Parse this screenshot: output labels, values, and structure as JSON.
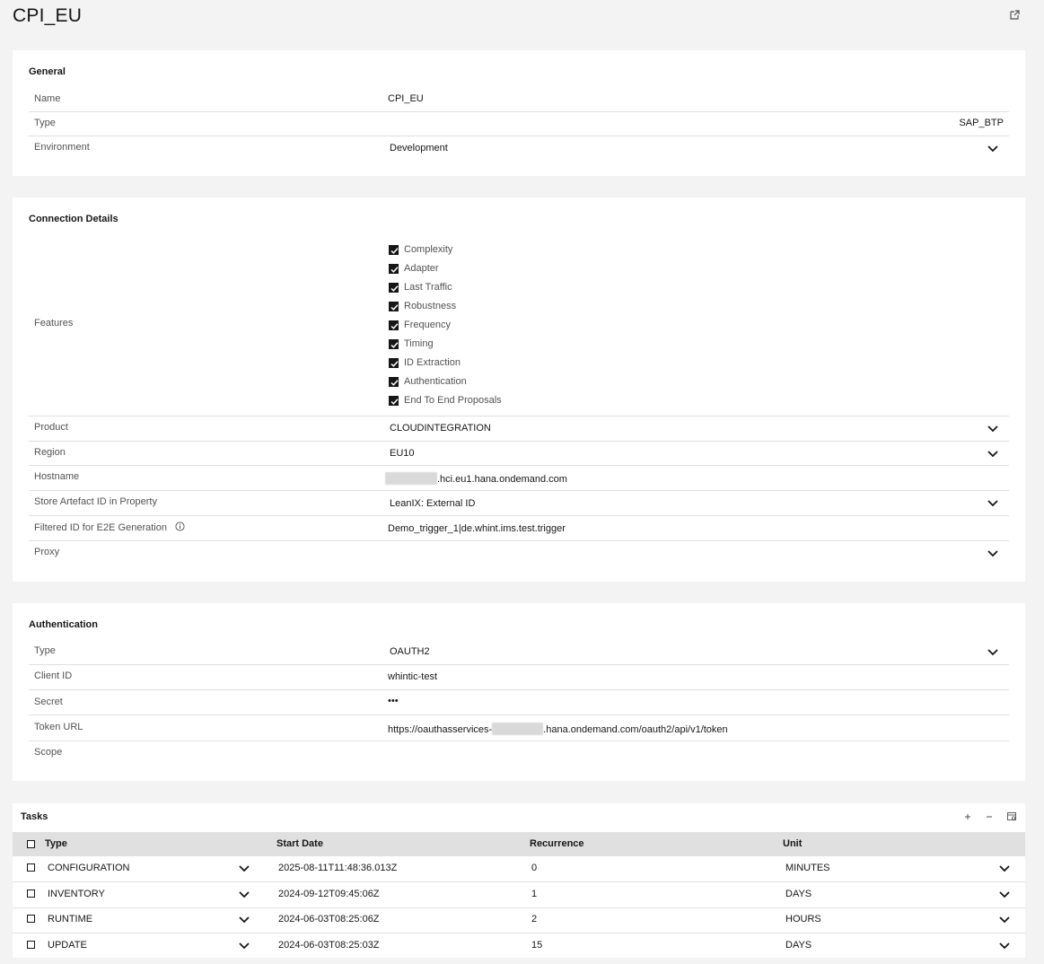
{
  "page": {
    "title": "CPI_EU"
  },
  "general": {
    "title": "General",
    "rows": [
      {
        "label": "Name",
        "value": "CPI_EU"
      },
      {
        "label": "Type",
        "value": "SAP_BTP"
      },
      {
        "label": "Environment",
        "value": "Development"
      }
    ]
  },
  "connection": {
    "title": "Connection Details",
    "features_label": "Features",
    "features": [
      "Complexity",
      "Adapter",
      "Last Traffic",
      "Robustness",
      "Frequency",
      "Timing",
      "ID Extraction",
      "Authentication",
      "End To End Proposals"
    ],
    "product": {
      "label": "Product",
      "value": "CLOUDINTEGRATION"
    },
    "region": {
      "label": "Region",
      "value": "EU10"
    },
    "hostname": {
      "label": "Hostname",
      "value": ".hci.eu1.hana.ondemand.com"
    },
    "store": {
      "label": "Store Artefact ID in Property",
      "value": "LeanIX: External ID"
    },
    "filtered": {
      "label": "Filtered ID for E2E Generation",
      "value": "Demo_trigger_1|de.whint.ims.test.trigger"
    },
    "proxy": {
      "label": "Proxy",
      "value": ""
    }
  },
  "auth": {
    "title": "Authentication",
    "type": {
      "label": "Type",
      "value": "OAUTH2"
    },
    "client": {
      "label": "Client ID",
      "value": "whintic-test"
    },
    "secret": {
      "label": "Secret",
      "value": "•••"
    },
    "token": {
      "label": "Token URL",
      "prefix": "https://oauthasservices-",
      "suffix": ".hana.ondemand.com/oauth2/api/v1/token"
    },
    "scope": {
      "label": "Scope",
      "value": ""
    }
  },
  "tasks": {
    "title": "Tasks",
    "columns": {
      "type": "Type",
      "start": "Start Date",
      "recurrence": "Recurrence",
      "unit": "Unit"
    },
    "rows": [
      {
        "type": "CONFIGURATION",
        "start": "2025-08-11T11:48:36.013Z",
        "recurrence": "0",
        "unit": "MINUTES"
      },
      {
        "type": "INVENTORY",
        "start": "2024-09-12T09:45:06Z",
        "recurrence": "1",
        "unit": "DAYS"
      },
      {
        "type": "RUNTIME",
        "start": "2024-06-03T08:25:06Z",
        "recurrence": "2",
        "unit": "HOURS"
      },
      {
        "type": "UPDATE",
        "start": "2024-06-03T08:25:03Z",
        "recurrence": "15",
        "unit": "DAYS"
      }
    ]
  },
  "icons": {
    "launch": "launch-icon",
    "chevron": "chevron-down-icon",
    "info": "information-icon",
    "add": "add-icon",
    "remove": "subtract-icon",
    "settings": "table-settings-icon"
  }
}
